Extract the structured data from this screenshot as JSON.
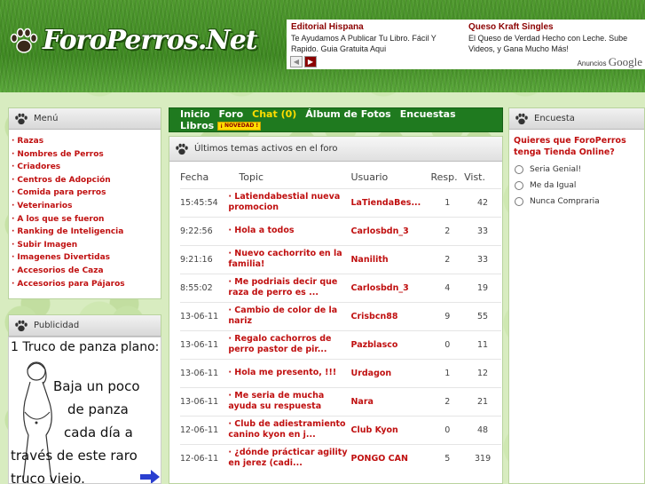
{
  "header": {
    "logo_text": "ForoPerros.Net"
  },
  "ads": {
    "ad1": {
      "title": "Editorial Hispana",
      "body": "Te Ayudamos A Publicar Tu Libro. Fácil Y Rapido. Guia Gratuita Aqui"
    },
    "ad2": {
      "title": "Queso Kraft Singles",
      "body": "El Queso de Verdad Hecho con Leche. Sube Videos, y Gana Mucho Más!"
    },
    "prev_arrow": "◀",
    "next_arrow": "▶",
    "ads_by_label": "Anuncios",
    "ads_by_brand": "Google"
  },
  "menu": {
    "title": "Menú",
    "items": [
      "Razas",
      "Nombres de Perros",
      "Criadores",
      "Centros de Adopción",
      "Comida para perros",
      "Veterinarios",
      "A los que se fueron",
      "Ranking de Inteligencia",
      "Subir Imagen",
      "Imagenes Divertidas",
      "Accesorios de Caza",
      "Accesorios para Pájaros"
    ]
  },
  "publicidad": {
    "title": "Publicidad",
    "ad_lines": [
      "1 Truco de panza plano:",
      "Baja un poco",
      "de panza",
      "cada día a",
      "través de este raro",
      "truco viejo."
    ]
  },
  "nav": {
    "inicio": "Inicio",
    "foro": "Foro",
    "chat": "Chat (0)",
    "album": "Álbum de Fotos",
    "encuestas": "Encuestas",
    "libros": "Libros",
    "novedad": "¡ NOVEDAD !"
  },
  "topics": {
    "title": "Últimos temas activos en el foro",
    "columns": {
      "fecha": "Fecha",
      "topic": "Topic",
      "usuario": "Usuario",
      "resp": "Resp.",
      "vist": "Vist."
    },
    "rows": [
      {
        "fecha": "15:45:54",
        "tema": "· Latiendabestial nueva promocion",
        "usuario": "LaTiendaBes...",
        "resp": "1",
        "vist": "42"
      },
      {
        "fecha": "9:22:56",
        "tema": "· Hola a todos",
        "usuario": "Carlosbdn_3",
        "resp": "2",
        "vist": "33"
      },
      {
        "fecha": "9:21:16",
        "tema": "· Nuevo cachorrito en la familia!",
        "usuario": "Nanilith",
        "resp": "2",
        "vist": "33"
      },
      {
        "fecha": "8:55:02",
        "tema": "· Me podriais decir que raza de perro es ...",
        "usuario": "Carlosbdn_3",
        "resp": "4",
        "vist": "19"
      },
      {
        "fecha": "13-06-11",
        "tema": "· Cambio de color de la nariz",
        "usuario": "Crisbcn88",
        "resp": "9",
        "vist": "55"
      },
      {
        "fecha": "13-06-11",
        "tema": "· Regalo cachorros de perro pastor de pir...",
        "usuario": "Pazblasco",
        "resp": "0",
        "vist": "11"
      },
      {
        "fecha": "13-06-11",
        "tema": "· Hola me presento, !!!",
        "usuario": "Urdagon",
        "resp": "1",
        "vist": "12"
      },
      {
        "fecha": "13-06-11",
        "tema": "· Me seria de mucha ayuda su respuesta",
        "usuario": "Nara",
        "resp": "2",
        "vist": "21"
      },
      {
        "fecha": "12-06-11",
        "tema": "· Club de adiestramiento canino kyon en j...",
        "usuario": "Club Kyon",
        "resp": "0",
        "vist": "48"
      },
      {
        "fecha": "12-06-11",
        "tema": "· ¿dónde prácticar agility en jerez (cadi...",
        "usuario": "PONGO CAN",
        "resp": "5",
        "vist": "319"
      }
    ]
  },
  "poll": {
    "title": "Encuesta",
    "question": "Quieres que ForoPerros tenga Tienda Online?",
    "options": [
      "Seria Genial!",
      "Me da Igual",
      "Nunca Compraria"
    ]
  },
  "colors": {
    "accent_red": "#c01010",
    "nav_green": "#1f7a1f",
    "chat_yellow": "#ffdd00"
  }
}
